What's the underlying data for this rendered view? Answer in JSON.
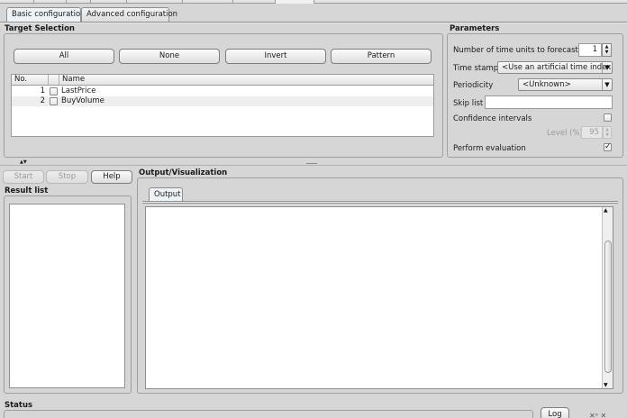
{
  "tabs": {
    "basic": "Basic configuration",
    "advanced": "Advanced configuration"
  },
  "target_selection": {
    "title": "Target Selection",
    "buttons": {
      "all": "All",
      "none": "None",
      "invert": "Invert",
      "pattern": "Pattern"
    },
    "columns": {
      "no": "No.",
      "name": "Name"
    },
    "rows": [
      {
        "no": "1",
        "name": "LastPrice",
        "checked": false
      },
      {
        "no": "2",
        "name": "BuyVolume",
        "checked": false
      }
    ]
  },
  "parameters": {
    "title": "Parameters",
    "units_label": "Number of time units to forecast",
    "units_value": "1",
    "timestamp_label": "Time stamp",
    "timestamp_value": "<Use an artificial time index>",
    "periodicity_label": "Periodicity",
    "periodicity_value": "<Unknown>",
    "skip_label": "Skip list",
    "skip_value": "",
    "confidence_label": "Confidence intervals",
    "confidence_checked": false,
    "level_label": "Level (%)",
    "level_value": "95",
    "evaluation_label": "Perform evaluation",
    "evaluation_checked": true
  },
  "controls": {
    "start": "Start",
    "stop": "Stop",
    "help": "Help"
  },
  "result_list": {
    "title": "Result list"
  },
  "output": {
    "title": "Output/Visualization",
    "tab": "Output"
  },
  "status": {
    "title": "Status",
    "log": "Log"
  }
}
